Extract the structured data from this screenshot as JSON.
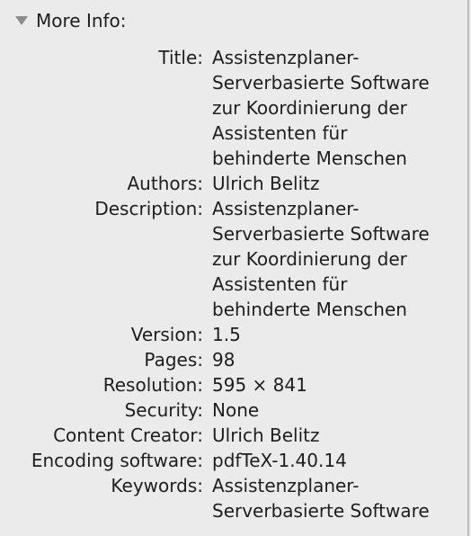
{
  "section": {
    "title": "More Info:",
    "icon": "disclosure-triangle-down-icon"
  },
  "fields": [
    {
      "label": "Title:",
      "value": "Assistenzplaner-\nServerbasierte Software\nzur Koordinierung der\nAssistenten für\nbehinderte Menschen"
    },
    {
      "label": "Authors:",
      "value": "Ulrich Belitz"
    },
    {
      "label": "Description:",
      "value": "Assistenzplaner-\nServerbasierte Software\nzur Koordinierung der\nAssistenten für\nbehinderte Menschen"
    },
    {
      "label": "Version:",
      "value": "1.5"
    },
    {
      "label": "Pages:",
      "value": "98"
    },
    {
      "label": "Resolution:",
      "value": "595 × 841"
    },
    {
      "label": "Security:",
      "value": "None"
    },
    {
      "label": "Content Creator:",
      "value": "Ulrich Belitz"
    },
    {
      "label": "Encoding software:",
      "value": "pdfTeX-1.40.14"
    },
    {
      "label": "Keywords:",
      "value": "Assistenzplaner-\nServerbasierte Software"
    }
  ]
}
